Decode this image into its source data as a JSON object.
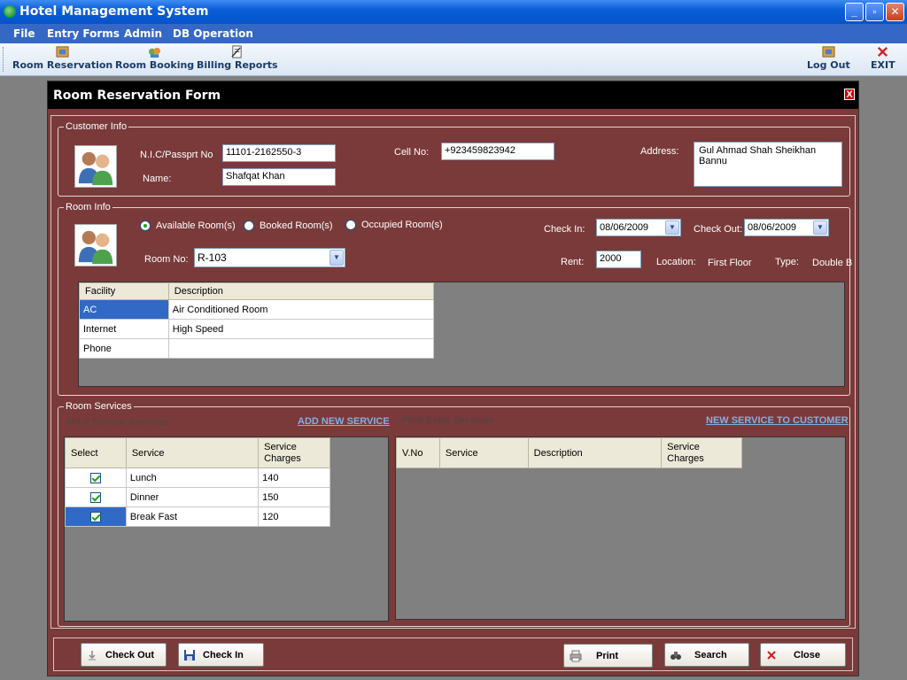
{
  "window": {
    "title": "Hotel Management System"
  },
  "menu": {
    "items": [
      "File",
      "Entry Forms",
      "Admin",
      "DB Operation"
    ]
  },
  "toolbar": {
    "room_reservation": "Room Reservation",
    "room_booking": "Room Booking",
    "billing_reports": "Billing Reports",
    "logout": "Log Out",
    "exit": "EXIT"
  },
  "form": {
    "title": "Room Reservation Form",
    "close_label": "X",
    "customer_info": {
      "title": "Customer Info",
      "nic_label": "N.I.C/Passprt No",
      "nic_value": "11101-2162550-3",
      "name_label": "Name:",
      "name_value": "Shafqat Khan",
      "cell_label": "Cell No:",
      "cell_value": "+923459823942",
      "address_label": "Address:",
      "address_value": "Gul Ahmad Shah Sheikhan Bannu"
    },
    "room_info": {
      "title": "Room Info",
      "radio_available": "Available Room(s)",
      "radio_booked": "Booked Room(s)",
      "radio_occupied": "Occupied Room(s)",
      "room_no_label": "Room No:",
      "room_no_value": "R-103",
      "check_in_label": "Check In:",
      "check_in_value": "08/06/2009",
      "check_out_label": "Check Out:",
      "check_out_value": "08/06/2009",
      "rent_label": "Rent:",
      "rent_value": "2000",
      "location_label": "Location:",
      "location_value": "First Floor",
      "type_label": "Type:",
      "type_value": "Double B",
      "facility_columns": [
        "Facility",
        "Description"
      ],
      "facilities": [
        {
          "facility": "AC",
          "description": "Air Conditioned Room"
        },
        {
          "facility": "Internet",
          "description": "High Speed"
        },
        {
          "facility": "Phone",
          "description": ""
        }
      ]
    },
    "room_services": {
      "title": "Room Services",
      "print_room_services": "Print Rooom Services",
      "add_new_service": "ADD NEW SERVICE",
      "print_extra_services": "Print Extra Services",
      "new_service_to_customer": "NEW SERVICE TO CUSTOMER",
      "services_columns": [
        "Select",
        "Service",
        "Service Charges"
      ],
      "services": [
        {
          "service": "Lunch",
          "charges": "140"
        },
        {
          "service": "Dinner",
          "charges": "150"
        },
        {
          "service": "Break Fast",
          "charges": "120"
        }
      ],
      "extra_columns": [
        "V.No",
        "Service",
        "Description",
        "Service Charges"
      ]
    },
    "buttons": {
      "check_out": "Check Out",
      "check_in": "Check In",
      "print": "Print",
      "search": "Search",
      "close": "Close"
    }
  }
}
